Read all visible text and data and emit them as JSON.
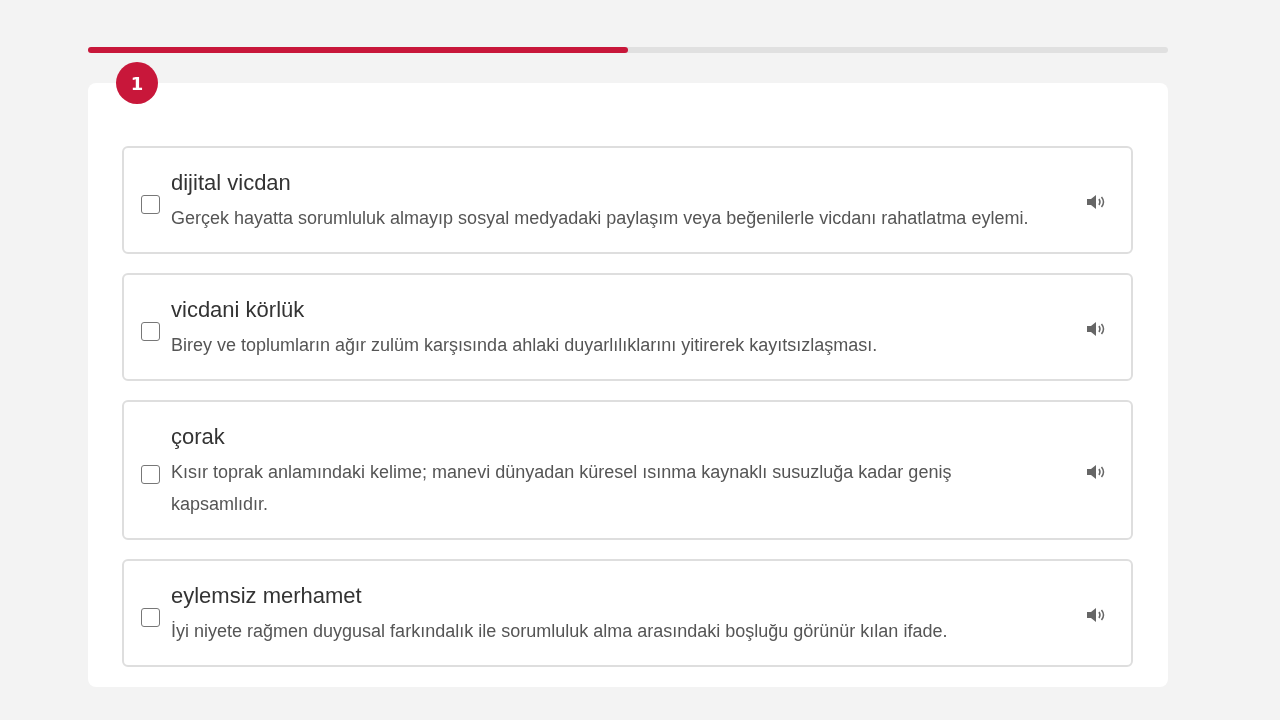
{
  "progress": {
    "level": 0.5
  },
  "question": {
    "number": "1"
  },
  "options": [
    {
      "term": "dijital vicdan",
      "definition": "Gerçek hayatta sorumluluk almayıp sosyal medyadaki paylaşım veya beğenilerle vicdanı rahatlatma eylemi.",
      "checked": false
    },
    {
      "term": "vicdani körlük",
      "definition": "Birey ve toplumların ağır zulüm karşısında ahlaki duyarlılıklarını yitirerek kayıtsızlaşması.",
      "checked": false
    },
    {
      "term": "çorak",
      "definition": "Kısır toprak anlamındaki kelime; manevi dünyadan küresel ısınma kaynaklı susuzluğa kadar geniş kapsamlıdır.",
      "checked": false
    },
    {
      "term": "eylemsiz merhamet",
      "definition": "İyi niyete rağmen duygusal farkındalık ile sorumluluk alma arasındaki boşluğu görünür kılan ifade.",
      "checked": false
    }
  ]
}
